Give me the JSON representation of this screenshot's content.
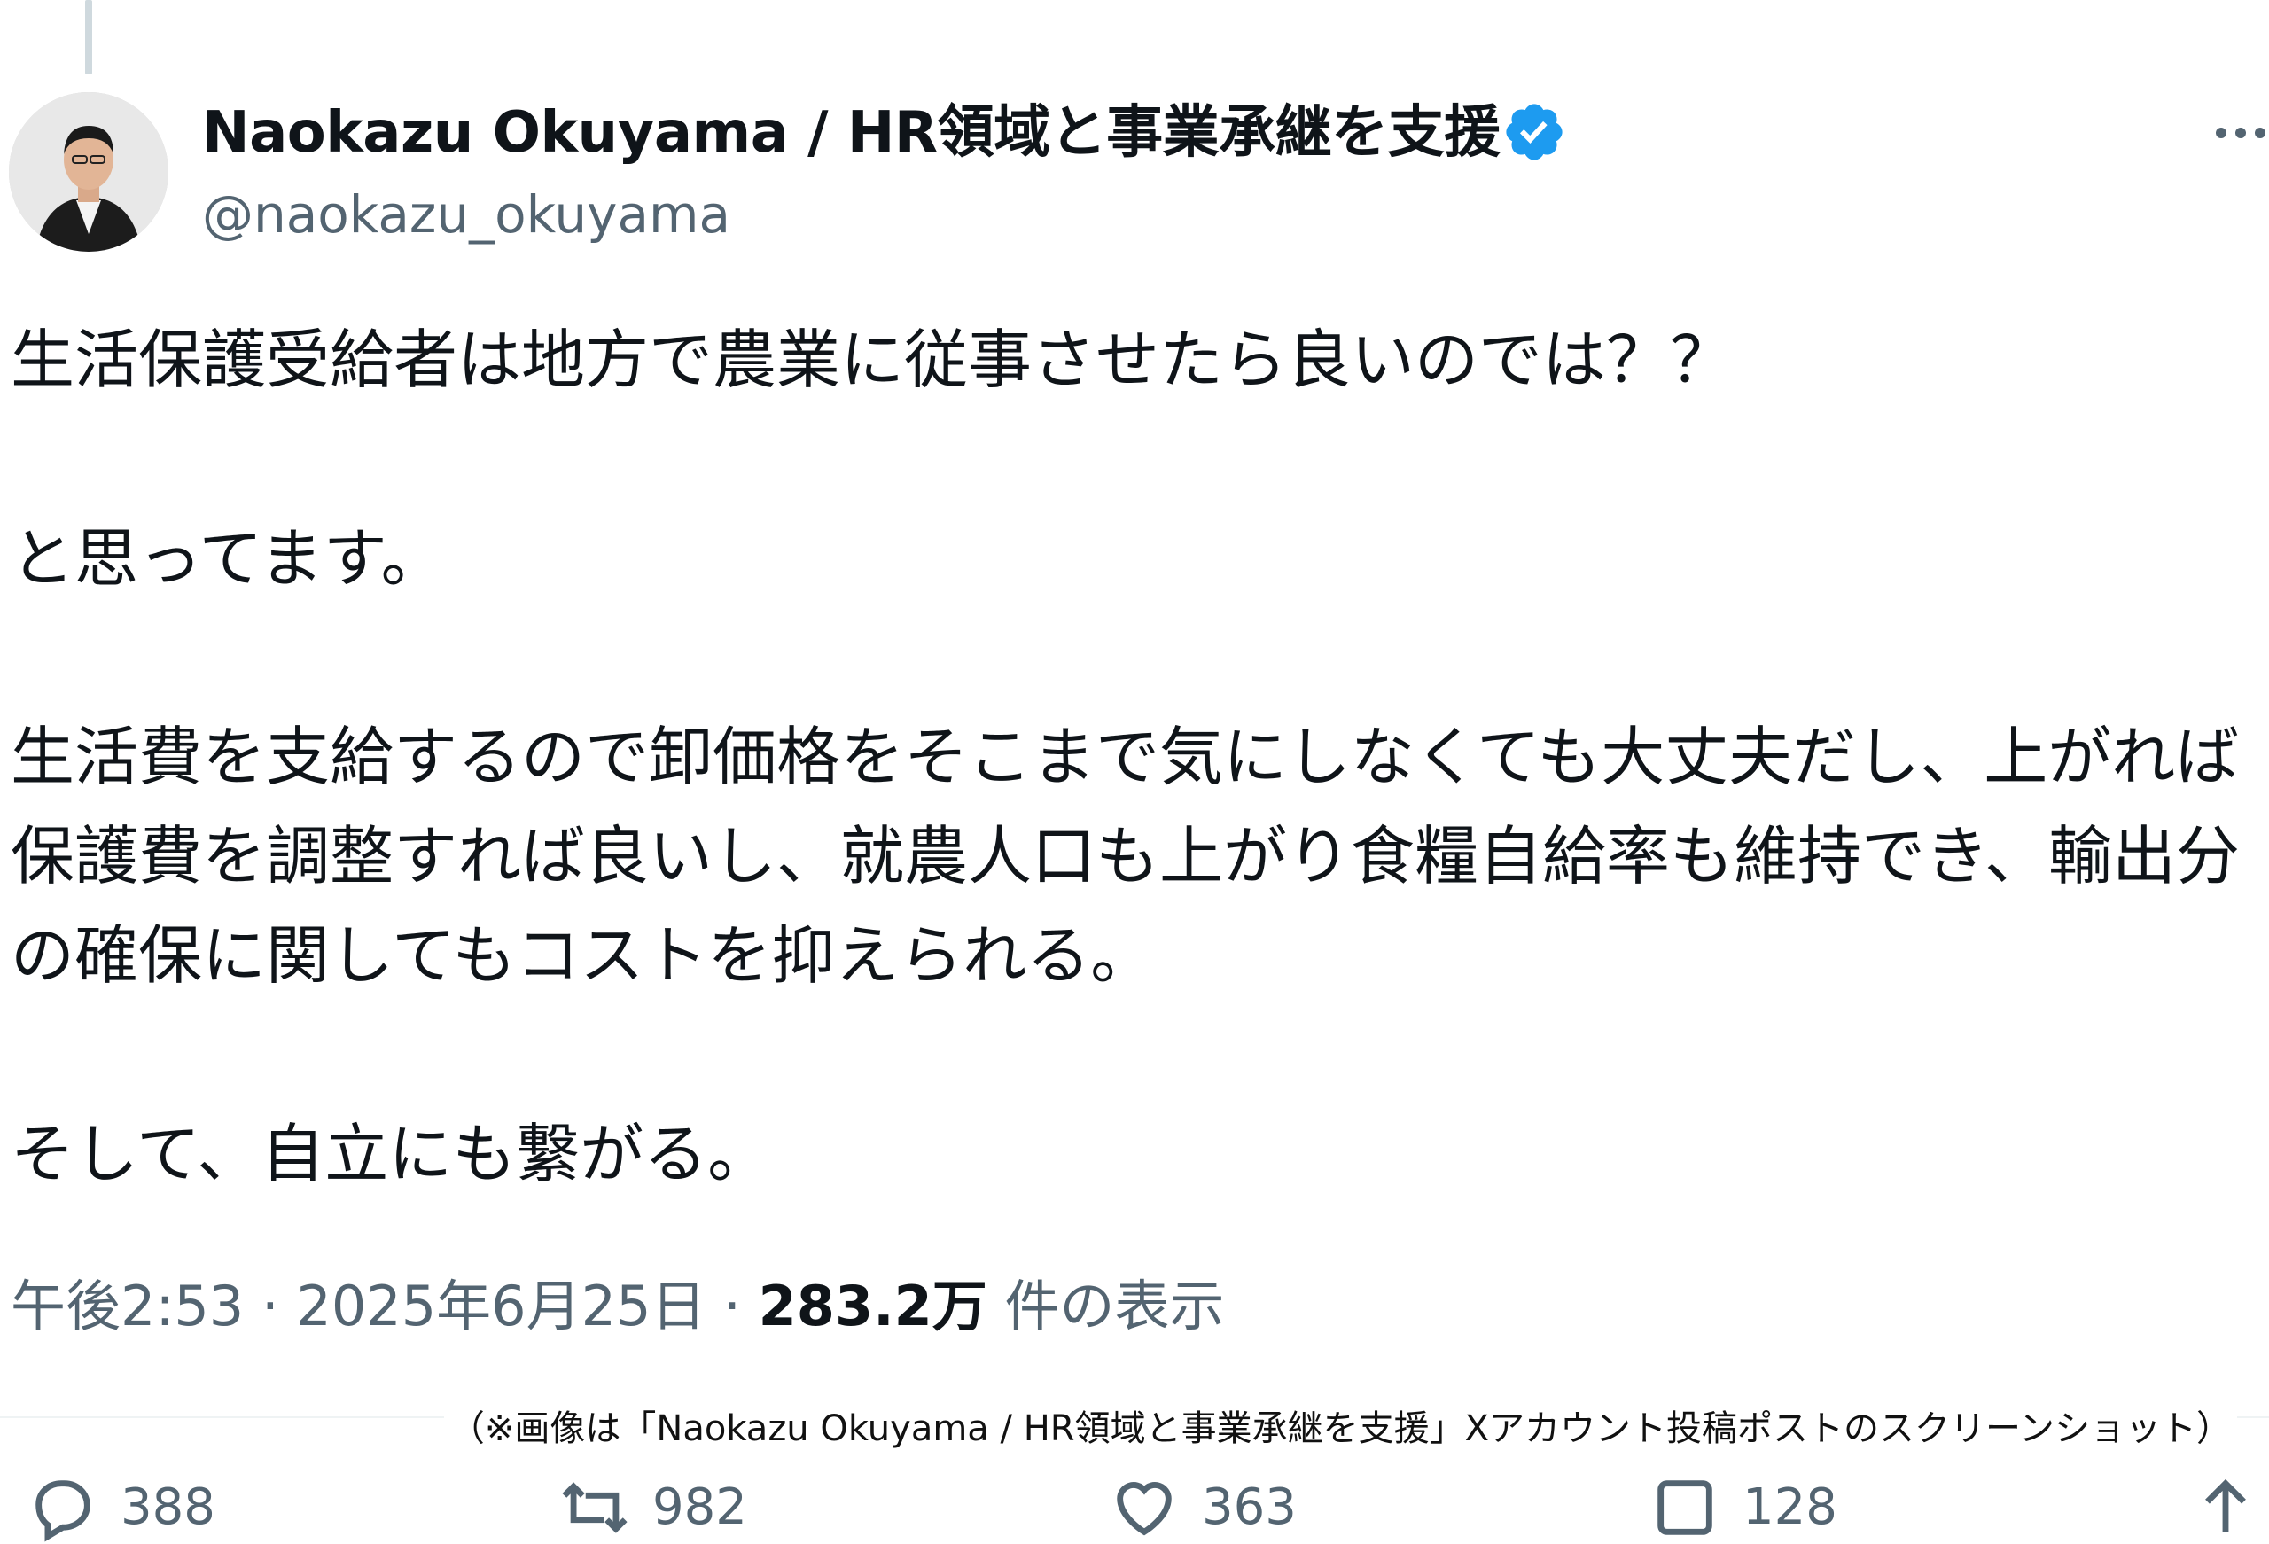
{
  "post": {
    "display_name": "Naokazu Okuyama / HR領域と事業承継を支援",
    "handle": "@naokazu_okuyama",
    "body": "生活保護受給者は地方で農業に従事させたら良いのでは？？\n\nと思ってます。\n\n生活費を支給するので卸価格をそこまで気にしなくても大丈夫だし、上がれば保護費を調整すれば良いし、就農人口も上がり食糧自給率も維持でき、輸出分の確保に関してもコストを抑えられる。\n\nそして、自立にも繋がる。",
    "time": "午後2:53",
    "date": "2025年6月25日",
    "separator": "·",
    "views_count": "283.2万",
    "views_label": "件の表示"
  },
  "caption": "（※画像は「Naokazu Okuyama / HR領域と事業承継を支援」Xアカウント投稿ポストのスクリーンショット）",
  "actions": {
    "replies": "388",
    "reposts": "982",
    "likes": "363",
    "bookmarks": "128"
  },
  "icons": {
    "verified": "verified-badge-icon",
    "more": "more-icon",
    "reply": "reply-icon",
    "repost": "repost-icon",
    "like": "heart-icon",
    "bookmark": "bookmark-icon",
    "share": "share-icon"
  },
  "colors": {
    "text": "#0f1419",
    "secondary": "#536471",
    "verified_blue": "#1d9bf0",
    "divider": "#eff3f4"
  }
}
